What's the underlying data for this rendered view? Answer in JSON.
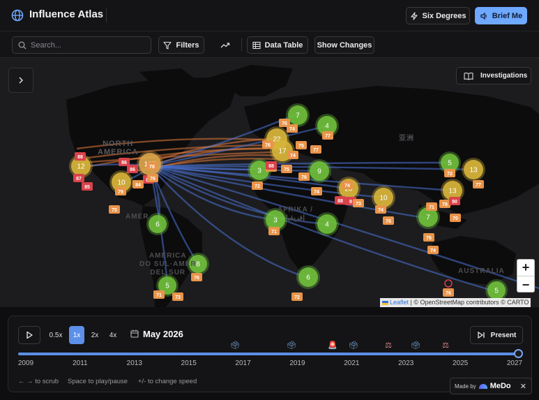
{
  "app": {
    "title": "Influence Atlas",
    "header_buttons": {
      "six_degrees": "Six Degrees",
      "brief_me": "Brief Me"
    }
  },
  "toolbar": {
    "search_placeholder": "Search...",
    "filters": "Filters",
    "data_table": "Data Table",
    "show_changes": "Show Changes"
  },
  "map": {
    "investigations": "Investigations",
    "labels": {
      "north_america": "NORTH\nAMERICA",
      "america_partial": "AMER",
      "south_america": "AMÉRICA\nDO SUL·AMÉR\nDEL SUR",
      "africa": "AFRIKA /\nإفريقيا",
      "asia": "亚洲",
      "australia": "AUSTRALIA"
    },
    "zoom_in": "+",
    "zoom_out": "−",
    "attribution_leaflet": "Leaflet",
    "attribution_rest": "| © OpenStreetMap contributors © CARTO",
    "clusters": [
      {
        "label": "12",
        "color": "#d7b43a"
      },
      {
        "label": "109",
        "color": "#d9a44a"
      },
      {
        "label": "10",
        "color": "#d7b43a"
      },
      {
        "label": "6",
        "color": "#6fbf3b"
      },
      {
        "label": "8",
        "color": "#6fbf3b"
      },
      {
        "label": "5",
        "color": "#6fbf3b"
      },
      {
        "label": "7",
        "color": "#6fbf3b"
      },
      {
        "label": "4",
        "color": "#6fbf3b"
      },
      {
        "label": "22",
        "color": "#d7b43a"
      },
      {
        "label": "17",
        "color": "#d7b43a"
      },
      {
        "label": "3",
        "color": "#6fbf3b"
      },
      {
        "label": "9",
        "color": "#6fbf3b"
      },
      {
        "label": "20",
        "color": "#d7b43a"
      },
      {
        "label": "10",
        "color": "#d7b43a"
      },
      {
        "label": "3",
        "color": "#6fbf3b"
      },
      {
        "label": "4",
        "color": "#6fbf3b"
      },
      {
        "label": "6",
        "color": "#6fbf3b"
      },
      {
        "label": "5",
        "color": "#6fbf3b"
      },
      {
        "label": "13",
        "color": "#d7b43a"
      },
      {
        "label": "13",
        "color": "#d7b43a"
      },
      {
        "label": "7",
        "color": "#6fbf3b"
      },
      {
        "label": "5",
        "color": "#6fbf3b"
      }
    ],
    "badges": [
      "88",
      "86",
      "87",
      "85",
      "86",
      "88",
      "76",
      "84",
      "79",
      "78",
      "75",
      "76",
      "74",
      "75",
      "77",
      "76",
      "74",
      "72",
      "75",
      "88",
      "72",
      "74",
      "76",
      "88",
      "8",
      "73",
      "74",
      "76",
      "72",
      "71",
      "77",
      "77",
      "71",
      "78",
      "90",
      "70",
      "76",
      "74",
      "74",
      "72",
      "76",
      "76",
      "71",
      "73"
    ]
  },
  "timeline": {
    "speeds": [
      "0.5x",
      "1x",
      "2x",
      "4x"
    ],
    "active_speed": "1x",
    "current_date": "May 2026",
    "present": "Present",
    "years": [
      "2009",
      "2011",
      "2013",
      "2015",
      "2017",
      "2019",
      "2021",
      "2023",
      "2025",
      "2027"
    ],
    "progress": 1.0,
    "event_icons": [
      "ballot-box",
      "ballot-box",
      "siren",
      "ballot-box",
      "scales",
      "ballot-box",
      "scales"
    ],
    "hints": [
      "← → to scrub",
      "Space to play/pause",
      "+/- to change speed"
    ]
  },
  "made_by": {
    "prefix": "Made by",
    "brand": "MeDo",
    "close": "✕"
  },
  "colors": {
    "accent": "#6ea8ff",
    "cluster_green": "#6fbf3b",
    "cluster_yellow": "#d7b43a",
    "badge_orange": "#e9944a",
    "badge_red": "#d9424a",
    "link_blue": "#4a72d6",
    "link_orange": "#e07a3a"
  }
}
